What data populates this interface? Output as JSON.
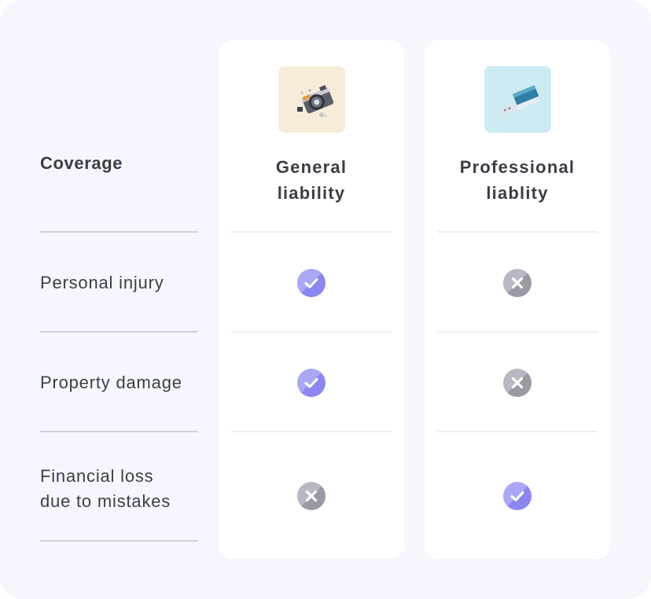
{
  "coverage": {
    "title": "Coverage",
    "rows": [
      {
        "label": "Personal injury"
      },
      {
        "label": "Property damage"
      },
      {
        "label": "Financial loss due to mistakes",
        "label_lines": [
          "Financial loss",
          "due to mistakes"
        ]
      }
    ]
  },
  "plans": [
    {
      "id": "general-liability",
      "title_lines": [
        "General",
        "liability"
      ],
      "image": "camera-photo",
      "image_bg": "#f7ecd9",
      "coverage": [
        "included",
        "included",
        "excluded"
      ]
    },
    {
      "id": "professional-liability",
      "title_lines": [
        "Professional",
        "liablity"
      ],
      "image": "usb-drive-photo",
      "image_bg": "#cdebf3",
      "coverage": [
        "excluded",
        "excluded",
        "included"
      ]
    }
  ],
  "colors": {
    "included": "#8b87ef",
    "excluded": "#9a99a4",
    "background": "#f6f7fe",
    "text": "#3b3d45"
  },
  "icons": {
    "included": "check-circle-icon",
    "excluded": "x-circle-icon"
  }
}
